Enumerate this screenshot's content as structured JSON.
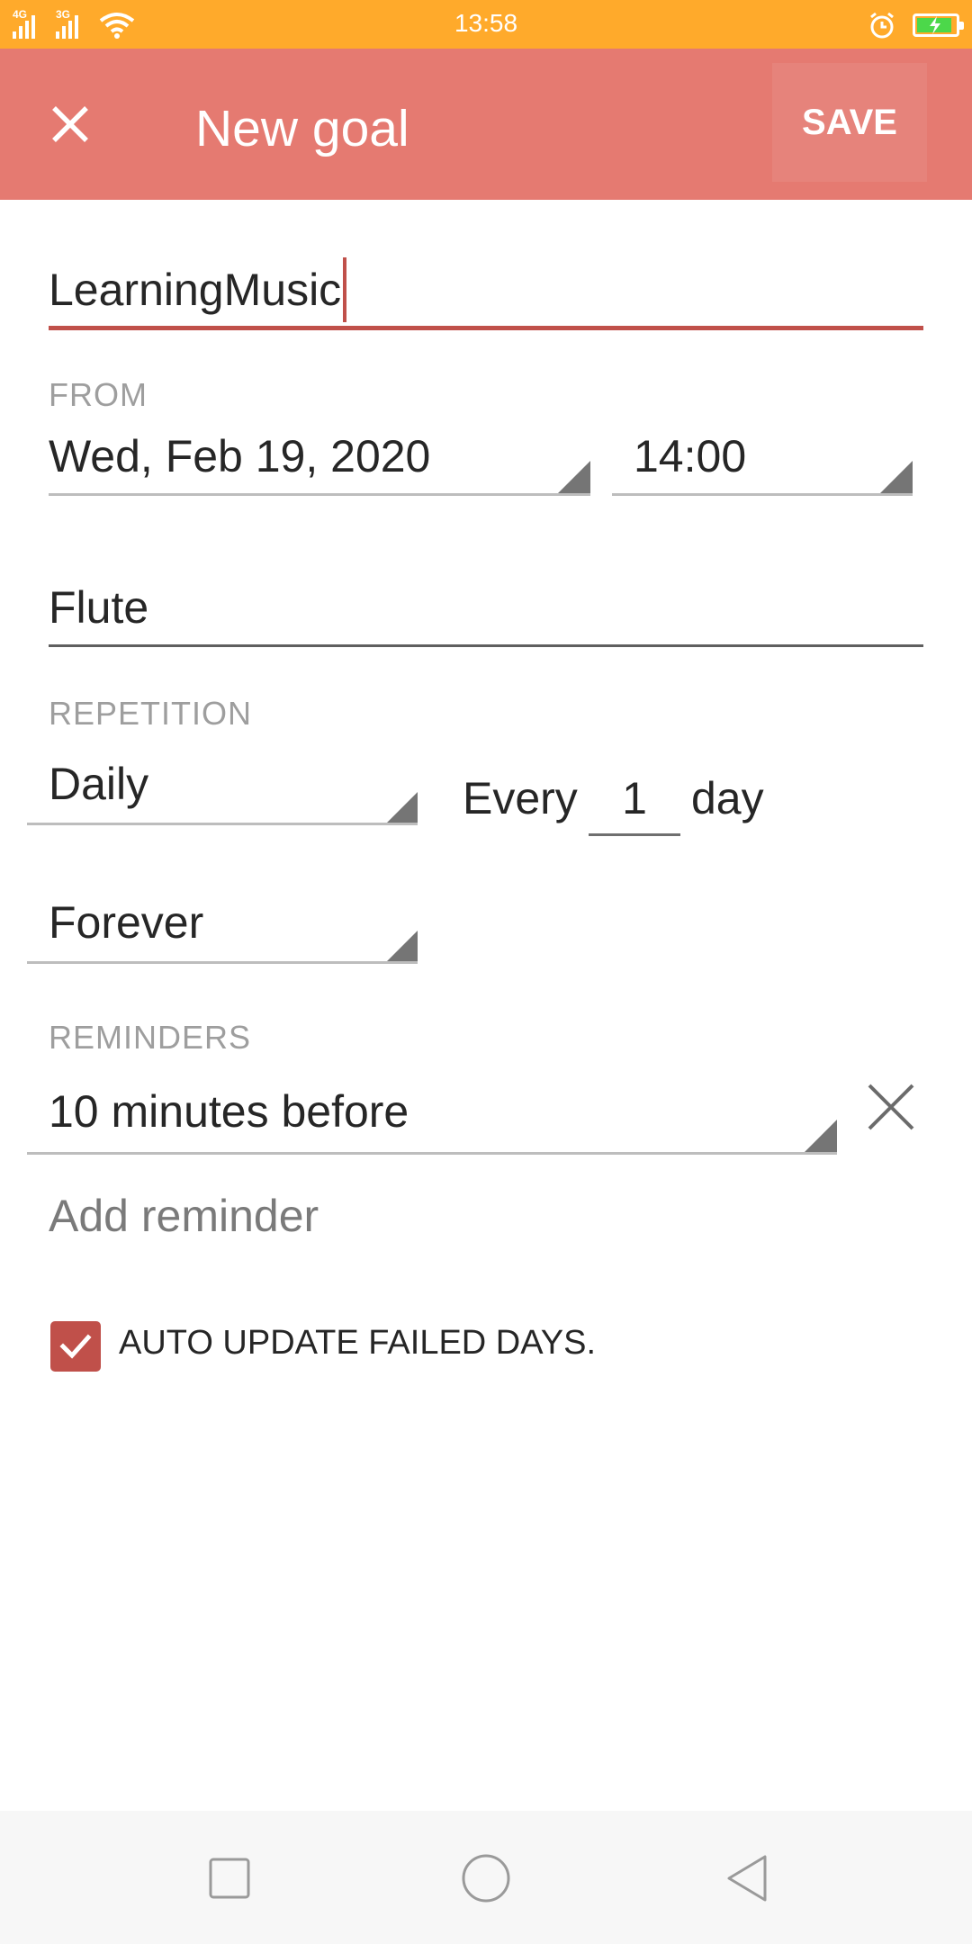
{
  "status_bar": {
    "network_left": "4G",
    "network_right": "3G",
    "time": "13:58",
    "icons": [
      "signal-icon",
      "signal-icon",
      "wifi-icon",
      "alarm-icon",
      "battery-charging-icon"
    ]
  },
  "app_bar": {
    "title": "New goal",
    "save_label": "SAVE",
    "close_icon": "close-icon"
  },
  "form": {
    "goal_name": "LearningMusic",
    "from": {
      "label": "FROM",
      "date": "Wed, Feb 19, 2020",
      "time": "14:00"
    },
    "category": "Flute",
    "repetition": {
      "label": "REPETITION",
      "frequency": "Daily",
      "every_label": "Every",
      "interval": "1",
      "unit": "day",
      "duration": "Forever"
    },
    "reminders": {
      "label": "REMINDERS",
      "items": [
        {
          "text": "10 minutes before"
        }
      ],
      "add_label": "Add reminder"
    },
    "auto_update": {
      "label": "AUTO UPDATE FAILED DAYS.",
      "checked": true
    }
  },
  "colors": {
    "status_bar": "#ffaa2b",
    "app_bar": "#e57a71",
    "accent": "#c0504a"
  },
  "nav_bar": {
    "icons": [
      "recent-apps-icon",
      "home-icon",
      "back-icon"
    ]
  }
}
